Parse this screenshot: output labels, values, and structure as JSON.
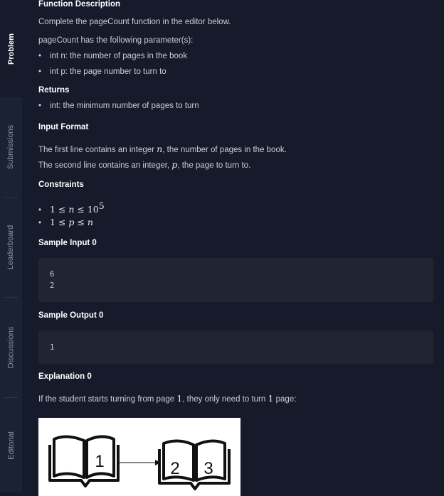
{
  "sidebar": {
    "tabs": [
      {
        "label": "Problem",
        "active": true
      },
      {
        "label": "Submissions",
        "active": false
      },
      {
        "label": "Leaderboard",
        "active": false
      },
      {
        "label": "Discussions",
        "active": false
      },
      {
        "label": "Editorial",
        "active": false
      }
    ]
  },
  "function_description": {
    "heading": "Function Description",
    "intro": "Complete the pageCount function in the editor below.",
    "params_intro": "pageCount has the following parameter(s):",
    "params": [
      "int n: the number of pages in the book",
      "int p: the page number to turn to"
    ]
  },
  "returns": {
    "heading": "Returns",
    "items": [
      "int: the minimum number of pages to turn"
    ]
  },
  "input_format": {
    "heading": "Input Format",
    "line1_pre": "The first line contains an integer ",
    "line1_var": "n",
    "line1_post": ", the number of pages in the book.",
    "line2_pre": "The second line contains an integer, ",
    "line2_var": "p",
    "line2_post": ", the page to turn to."
  },
  "constraints": {
    "heading": "Constraints",
    "c1_a": "1 ≤ ",
    "c1_var": "n",
    "c1_b": " ≤ 10",
    "c1_exp": "5",
    "c2_a": "1 ≤ ",
    "c2_var": "p",
    "c2_b": " ≤ ",
    "c2_var2": "n"
  },
  "sample_input": {
    "heading": "Sample Input 0",
    "lines": [
      "6",
      "2"
    ]
  },
  "sample_output": {
    "heading": "Sample Output 0",
    "lines": [
      "1"
    ]
  },
  "explanation": {
    "heading": "Explanation 0",
    "text_pre": "If the student starts turning from page ",
    "num1": "1",
    "text_mid": ", they only need to turn ",
    "num2": "1",
    "text_post": " page:",
    "diagram_labels": [
      "1",
      "2",
      "3"
    ]
  },
  "colors": {
    "background": "#151b2a",
    "sidebar": "#1b2233",
    "code_bg": "#1f2533",
    "heading": "#ffffff",
    "text": "#c9ced6"
  }
}
